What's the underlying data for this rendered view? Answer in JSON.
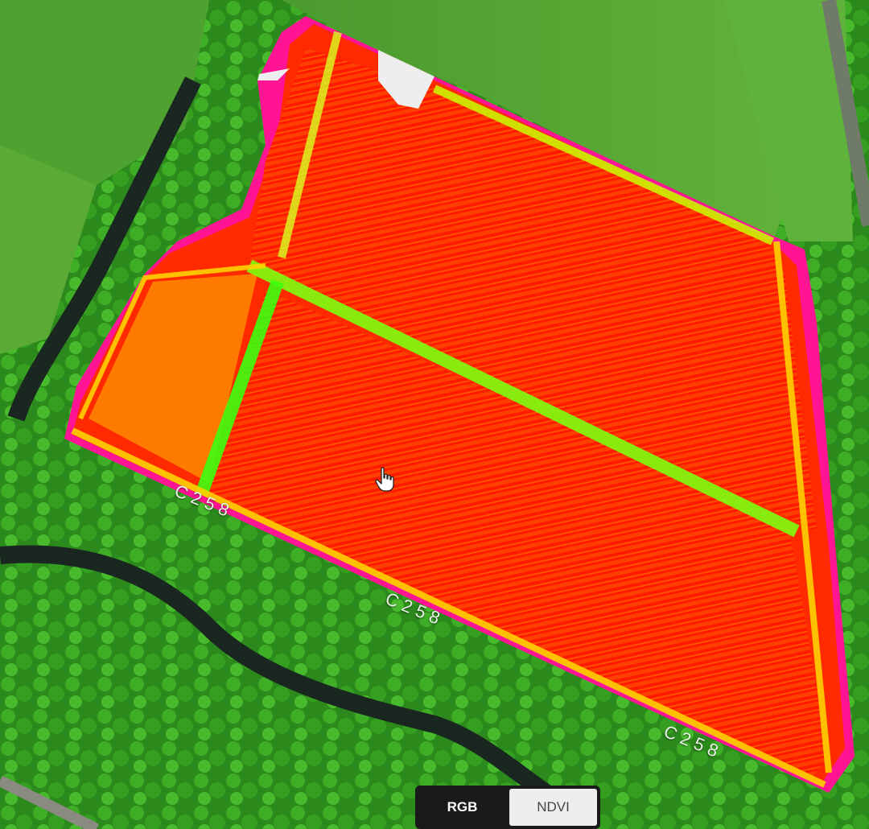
{
  "map": {
    "road_labels": [
      "C258",
      "C258",
      "C258"
    ],
    "layer_active": "NDVI",
    "ndvi_palette": [
      "#ff0000",
      "#ff4a00",
      "#ffd000",
      "#c8ff00",
      "#22ff00",
      "#ff1494"
    ],
    "background_palette": [
      "#2f7a1e",
      "#4caf2a",
      "#6bbf3f",
      "#1a2a14"
    ]
  },
  "toggle": {
    "rgb_label": "RGB",
    "ndvi_label": "NDVI"
  },
  "cursor": {
    "icon": "hand-pointer-icon"
  }
}
